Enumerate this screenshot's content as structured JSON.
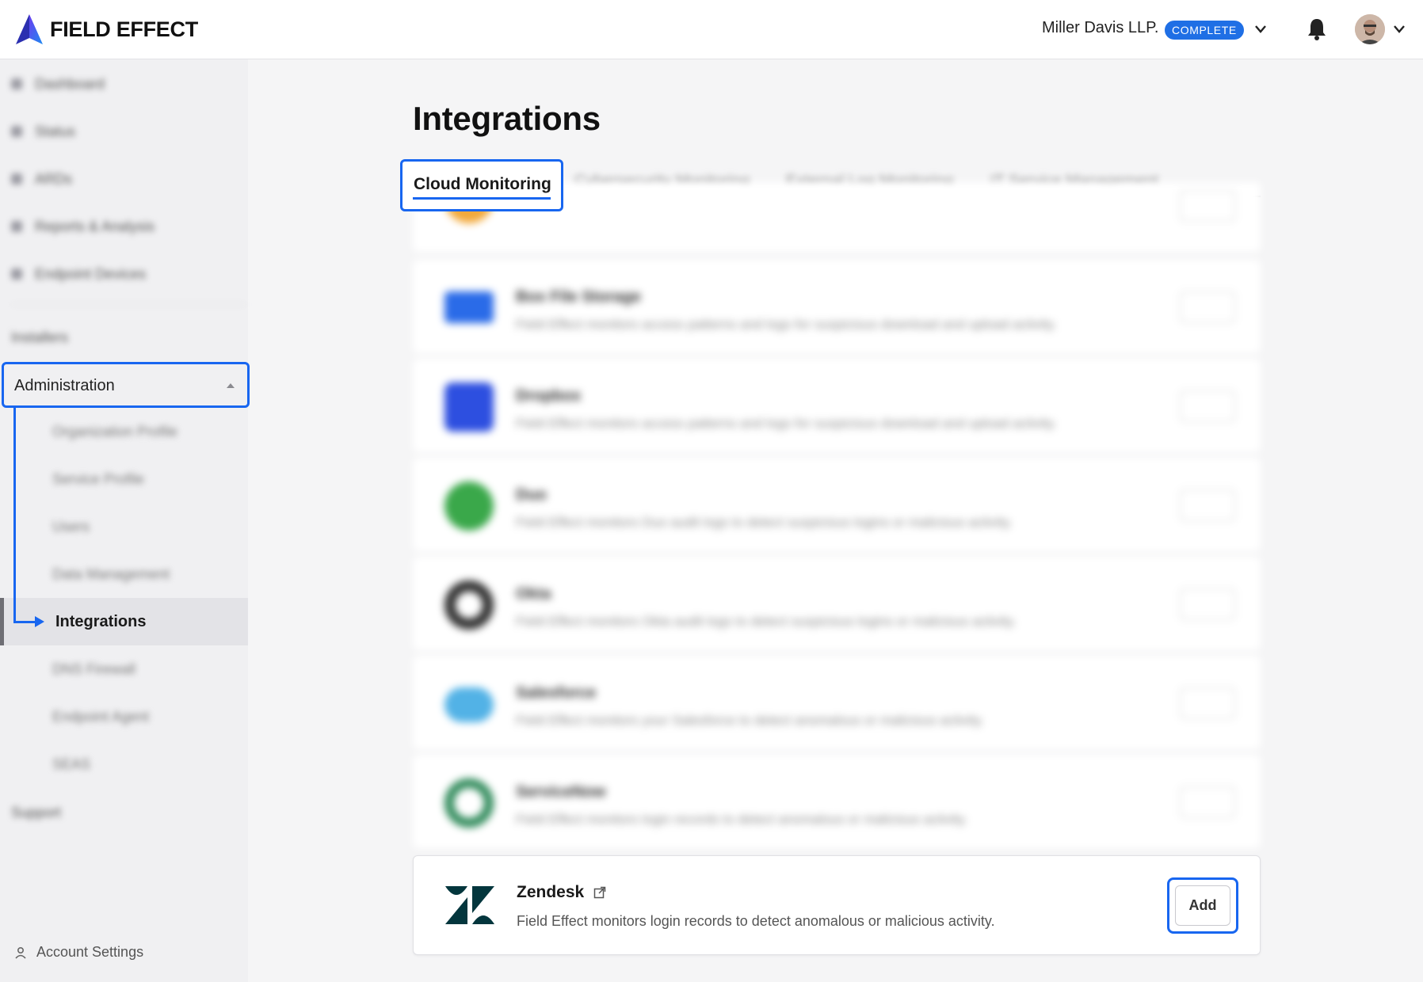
{
  "header": {
    "brand": "FIELD EFFECT",
    "organization": "Miller Davis LLP.",
    "plan_badge": "COMPLETE"
  },
  "sidebar": {
    "items": [
      {
        "label": "Dashboard"
      },
      {
        "label": "Status"
      },
      {
        "label": "ARDs"
      },
      {
        "label": "Reports & Analysis"
      },
      {
        "label": "Endpoint Devices"
      }
    ],
    "installers": "Installers",
    "administration": {
      "label": "Administration",
      "subitems": [
        {
          "label": "Organization Profile"
        },
        {
          "label": "Service Profile"
        },
        {
          "label": "Users"
        },
        {
          "label": "Data Management"
        },
        {
          "label": "Integrations"
        },
        {
          "label": "DNS Firewall"
        },
        {
          "label": "Endpoint Agent"
        },
        {
          "label": "SEAS"
        }
      ]
    },
    "support": "Support",
    "account_settings": "Account Settings"
  },
  "main": {
    "title": "Integrations",
    "tabs": [
      {
        "label": "Cloud Monitoring",
        "active": true
      },
      {
        "label": "Cybersecurity Monitoring"
      },
      {
        "label": "External Log Monitoring"
      },
      {
        "label": "IT Service Management"
      }
    ],
    "integrations": [
      {
        "name": "Box File Storage",
        "desc": "Field Effect monitors access patterns and logs for suspicious download and upload activity.",
        "color": "#2a6be8"
      },
      {
        "name": "Dropbox",
        "desc": "Field Effect monitors access patterns and logs for suspicious download and upload activity.",
        "color": "#2d4fe0"
      },
      {
        "name": "Duo",
        "desc": "Field Effect monitors Duo audit logs to detect suspicious logins or malicious activity.",
        "color": "#3aa84a"
      },
      {
        "name": "Okta",
        "desc": "Field Effect monitors Okta audit logs to detect suspicious logins or malicious activity.",
        "color": "#333333"
      },
      {
        "name": "Salesforce",
        "desc": "Field Effect monitors your Salesforce to detect anomalous or malicious activity.",
        "color": "#52b2e6"
      },
      {
        "name": "ServiceNow",
        "desc": "Field Effect monitors login records to detect anomalous or malicious activity.",
        "color": "#2f8a5a"
      }
    ],
    "zendesk": {
      "name": "Zendesk",
      "desc": "Field Effect monitors login records to detect anomalous or malicious activity.",
      "add_label": "Add"
    }
  },
  "colors": {
    "accent": "#1866f0",
    "badge": "#1f6fe5"
  }
}
